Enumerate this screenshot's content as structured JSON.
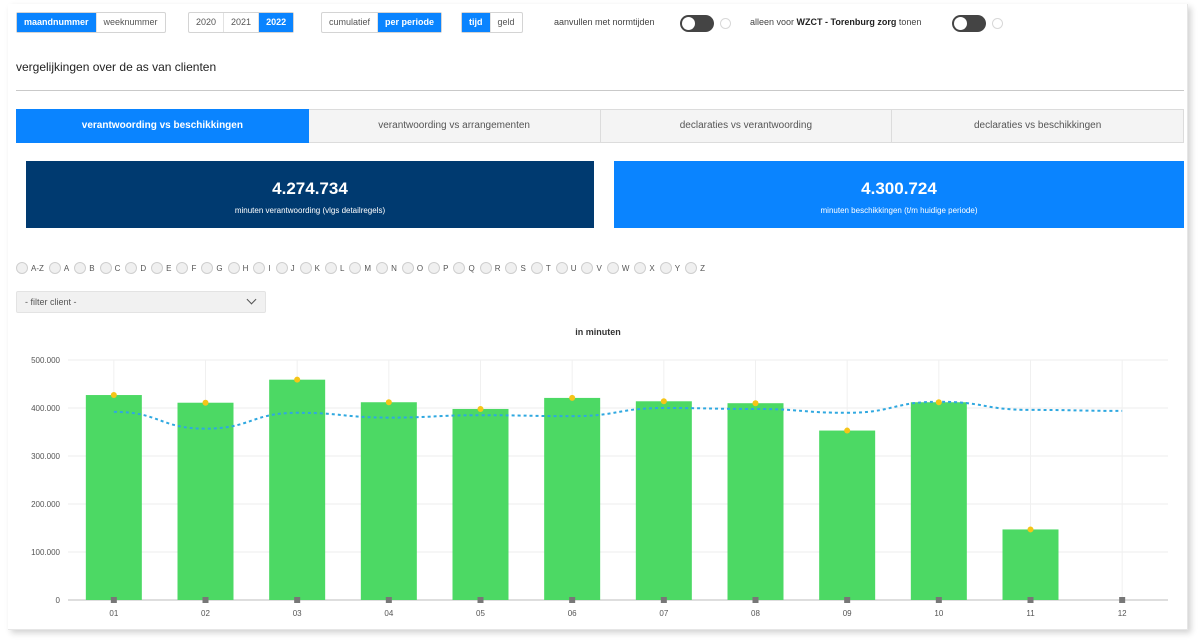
{
  "toolbar": {
    "period_type": {
      "options": [
        "maandnummer",
        "weeknummer"
      ],
      "selected": "maandnummer"
    },
    "years": {
      "options": [
        "2020",
        "2021",
        "2022"
      ],
      "selected": "2022"
    },
    "mode": {
      "options": [
        "cumulatief",
        "per periode"
      ],
      "selected": "per periode"
    },
    "measure": {
      "options": [
        "tijd",
        "geld"
      ],
      "selected": "tijd"
    },
    "fill_norm_label": "aanvullen met normtijden",
    "only_for_prefix": "alleen voor",
    "only_for_org": "WZCT - Torenburg zorg",
    "only_for_suffix": "tonen"
  },
  "section_title": "vergelijkingen over de as van clienten",
  "tabs": [
    {
      "label": "verantwoording vs beschikkingen",
      "active": true
    },
    {
      "label": "verantwoording vs arrangementen",
      "active": false
    },
    {
      "label": "declaraties vs verantwoording",
      "active": false
    },
    {
      "label": "declaraties vs beschikkingen",
      "active": false
    }
  ],
  "kpis": {
    "left": {
      "value": "4.274.734",
      "label": "minuten verantwoording (vlgs detailregels)",
      "color": "#003a70"
    },
    "right": {
      "value": "4.300.724",
      "label": "minuten beschikkingen (t/m huidige periode)",
      "color": "#0a84ff"
    }
  },
  "letters": [
    "A-Z",
    "A",
    "B",
    "C",
    "D",
    "E",
    "F",
    "G",
    "H",
    "I",
    "J",
    "K",
    "L",
    "M",
    "N",
    "O",
    "P",
    "Q",
    "R",
    "S",
    "T",
    "U",
    "V",
    "W",
    "X",
    "Y",
    "Z"
  ],
  "filter": {
    "value": "- filter client -"
  },
  "icons": {
    "dropdown": "chevron-down-icon",
    "toggle": "toggle-switch"
  },
  "chart_data": {
    "type": "bar",
    "title": "in minuten",
    "categories": [
      "01",
      "02",
      "03",
      "04",
      "05",
      "06",
      "07",
      "08",
      "09",
      "10",
      "11",
      "12"
    ],
    "series": [
      {
        "type": "bar",
        "color": "#4cd964",
        "values": [
          427000,
          411000,
          459000,
          412000,
          398000,
          421000,
          414000,
          410000,
          353000,
          412000,
          147000,
          null
        ]
      },
      {
        "type": "line",
        "style": "dotted",
        "color": "#2fa8e0",
        "values": [
          392000,
          357000,
          390000,
          380000,
          385000,
          383000,
          400000,
          398000,
          390000,
          413000,
          396000,
          394000
        ]
      }
    ],
    "yticks": [
      "0",
      "100.000",
      "200.000",
      "300.000",
      "400.000",
      "500.000"
    ],
    "ylim": [
      0,
      500000
    ],
    "grid": true,
    "marker_color": "#f5c518"
  }
}
